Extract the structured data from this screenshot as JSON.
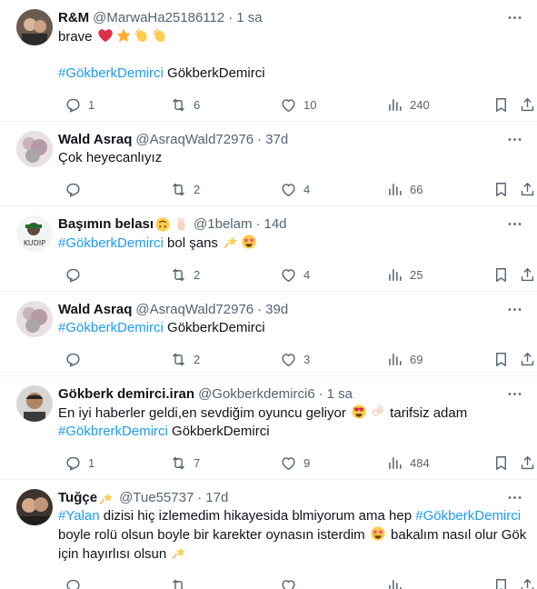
{
  "tweets": [
    {
      "name": "R&M",
      "handle": "@MarwaHa25186112",
      "time": "1 sa",
      "lines": [
        {
          "parts": [
            {
              "t": "text",
              "v": "brave "
            },
            {
              "t": "emoji",
              "v": "heart"
            },
            {
              "t": "emoji",
              "v": "star"
            },
            {
              "t": "emoji",
              "v": "clap"
            },
            {
              "t": "emoji",
              "v": "clap"
            }
          ]
        },
        {
          "parts": []
        },
        {
          "parts": [
            {
              "t": "tag",
              "v": "#GökberkDemirci"
            },
            {
              "t": "text",
              "v": " GökberkDemirci"
            }
          ]
        }
      ],
      "replies": "1",
      "retweets": "6",
      "likes": "10",
      "views": "240"
    },
    {
      "name": "Wald Asraq",
      "handle": "@AsraqWald72976",
      "time": "37d",
      "lines": [
        {
          "parts": [
            {
              "t": "text",
              "v": "Çok heyecanlıyız"
            }
          ]
        }
      ],
      "replies": "",
      "retweets": "2",
      "likes": "4",
      "views": "66"
    },
    {
      "name": "Başımın belası",
      "name_emojis": [
        "upside",
        "hand"
      ],
      "handle": "@1belam",
      "time": "14d",
      "lines": [
        {
          "parts": [
            {
              "t": "tag",
              "v": "#GökberkDemirci"
            },
            {
              "t": "text",
              "v": " bol şans "
            },
            {
              "t": "emoji",
              "v": "dizzy"
            },
            {
              "t": "emoji",
              "v": "starstruck"
            }
          ]
        }
      ],
      "replies": "",
      "retweets": "2",
      "likes": "4",
      "views": "25"
    },
    {
      "name": "Wald Asraq",
      "handle": "@AsraqWald72976",
      "time": "39d",
      "lines": [
        {
          "parts": [
            {
              "t": "tag",
              "v": "#GökberkDemirci"
            },
            {
              "t": "text",
              "v": " GökberkDemirci"
            }
          ]
        }
      ],
      "replies": "",
      "retweets": "2",
      "likes": "3",
      "views": "69"
    },
    {
      "name": "Gökberk demirci.iran",
      "handle": "@Gokberkdemirci6",
      "time": "1 sa",
      "lines": [
        {
          "parts": [
            {
              "t": "text",
              "v": "En iyi haberler geldi,en sevdiğim oyuncu geliyor "
            },
            {
              "t": "emoji",
              "v": "hearteyes"
            },
            {
              "t": "emoji",
              "v": "ok"
            },
            {
              "t": "text",
              "v": " tarifsiz adam"
            }
          ]
        },
        {
          "parts": [
            {
              "t": "tag",
              "v": "#GökbrerkDemirci"
            },
            {
              "t": "text",
              "v": " GökberkDemirci"
            }
          ]
        }
      ],
      "replies": "1",
      "retweets": "7",
      "likes": "9",
      "views": "484"
    },
    {
      "name": "Tuğçe",
      "name_emojis": [
        "dizzy"
      ],
      "handle": "@Tue55737",
      "time": "17d",
      "lines": [
        {
          "parts": [
            {
              "t": "tag",
              "v": "#Yalan"
            },
            {
              "t": "text",
              "v": " dizisi hiç izlemedim hikayesida blmiyorum ama hep "
            },
            {
              "t": "tag",
              "v": "#GökberkDemirci"
            }
          ]
        },
        {
          "parts": [
            {
              "t": "text",
              "v": "boyle rolü olsun boyle bir karekter oynasın isterdim "
            },
            {
              "t": "emoji",
              "v": "starstruck"
            },
            {
              "t": "text",
              "v": " bakalım nasıl olur Gök"
            }
          ]
        },
        {
          "parts": [
            {
              "t": "text",
              "v": "için hayırlısı olsun "
            },
            {
              "t": "emoji",
              "v": "dizzy"
            }
          ]
        }
      ],
      "replies": "",
      "retweets": "",
      "likes": "",
      "views": ""
    }
  ]
}
